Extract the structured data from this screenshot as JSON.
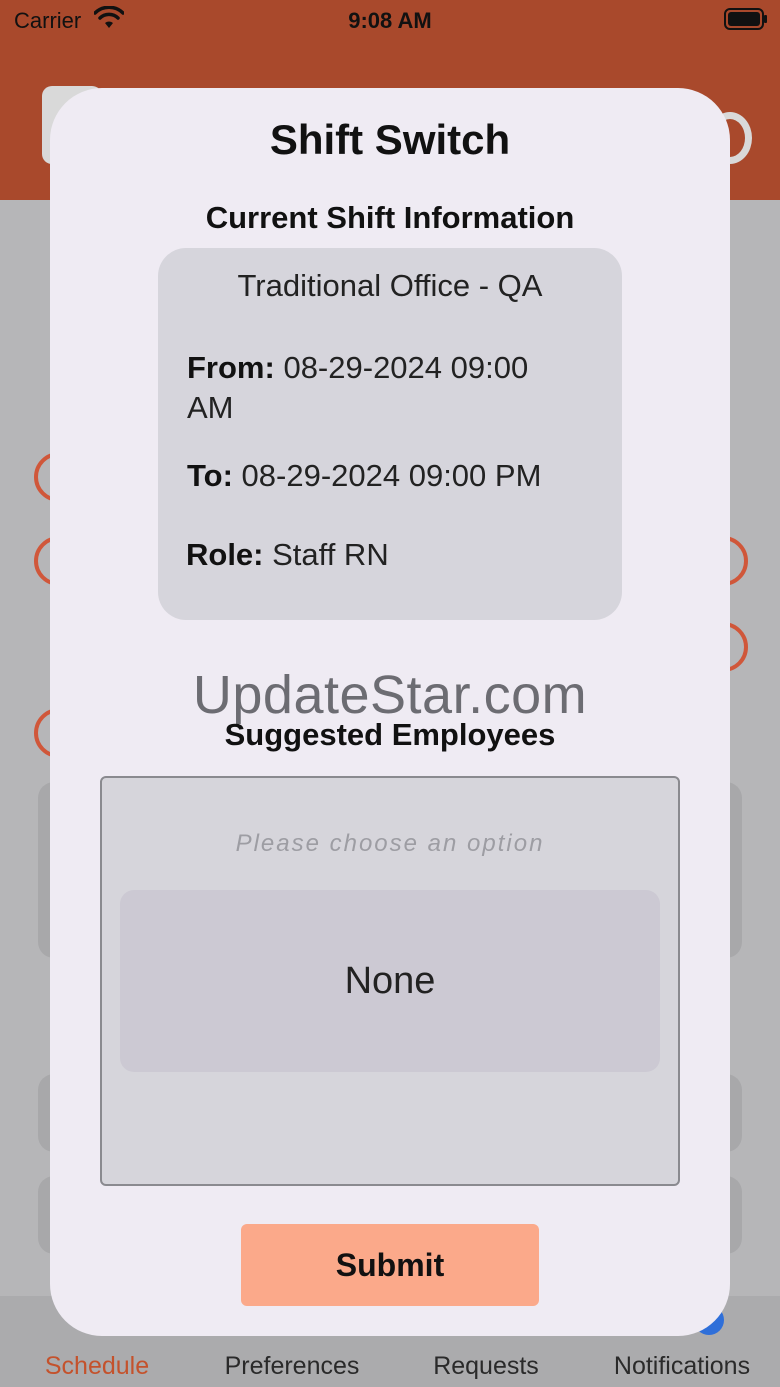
{
  "status_bar": {
    "carrier": "Carrier",
    "time": "9:08 AM"
  },
  "modal": {
    "title": "Shift Switch",
    "current_section_title": "Current Shift Information",
    "shift_name": "Traditional Office - QA",
    "from_label": "From:",
    "from_value": "08-29-2024 09:00",
    "from_value_cont": "AM",
    "to_label": "To:",
    "to_value": "08-29-2024 09:00 PM",
    "role_label": "Role:",
    "role_value": "Staff RN",
    "suggested_section_title": "Suggested Employees",
    "picker_placeholder": "Please choose an option",
    "picker_option_selected": "None",
    "submit_label": "Submit"
  },
  "watermark": "UpdateStar.com",
  "tab_bar": {
    "items": [
      {
        "label": "Schedule",
        "active": true
      },
      {
        "label": "Preferences",
        "active": false
      },
      {
        "label": "Requests",
        "active": false
      },
      {
        "label": "Notifications",
        "active": false
      }
    ]
  },
  "colors": {
    "header": "#a9492c",
    "accent": "#c4522c",
    "submit": "#fba98a",
    "modal_bg": "#efebf3"
  }
}
